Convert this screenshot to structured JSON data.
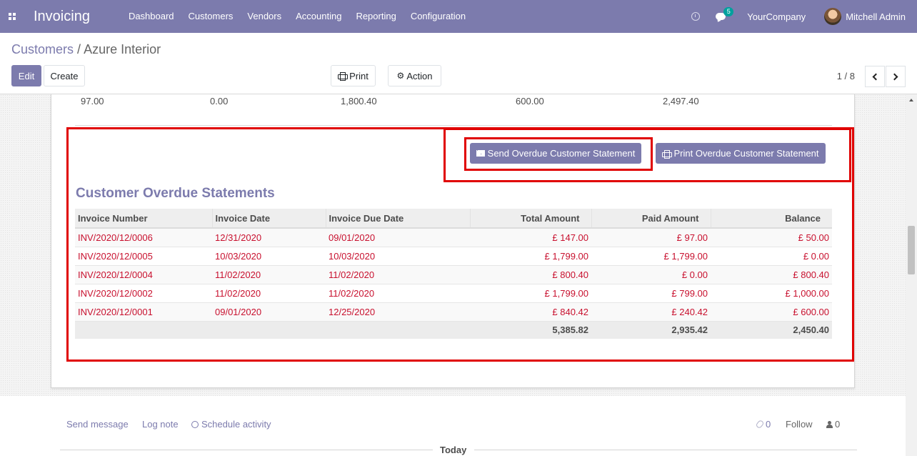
{
  "navbar": {
    "app_name": "Invoicing",
    "menu": [
      "Dashboard",
      "Customers",
      "Vendors",
      "Accounting",
      "Reporting",
      "Configuration"
    ],
    "chat_count": "5",
    "company": "YourCompany",
    "user": "Mitchell Admin",
    "bg_color": "#7c7bad"
  },
  "breadcrumb": {
    "parent": "Customers",
    "separator": "/",
    "current": "Azure Interior"
  },
  "toolbar": {
    "edit_label": "Edit",
    "create_label": "Create",
    "print_label": "Print",
    "action_label": "Action",
    "pager": "1 / 8"
  },
  "totals_row": [
    "97.00",
    "0.00",
    "1,800.40",
    "600.00",
    "2,497.40"
  ],
  "statement": {
    "send_label": "Send Overdue Customer Statement",
    "print_label": "Print Overdue Customer Statement",
    "title": "Customer Overdue Statements",
    "columns": [
      "Invoice Number",
      "Invoice Date",
      "Invoice Due Date",
      "Total Amount",
      "Paid Amount",
      "Balance"
    ],
    "rows": [
      [
        "INV/2020/12/0006",
        "12/31/2020",
        "09/01/2020",
        "£ 147.00",
        "£ 97.00",
        "£ 50.00"
      ],
      [
        "INV/2020/12/0005",
        "10/03/2020",
        "10/03/2020",
        "£ 1,799.00",
        "£ 1,799.00",
        "£ 0.00"
      ],
      [
        "INV/2020/12/0004",
        "11/02/2020",
        "11/02/2020",
        "£ 800.40",
        "£ 0.00",
        "£ 800.40"
      ],
      [
        "INV/2020/12/0002",
        "11/02/2020",
        "11/02/2020",
        "£ 1,799.00",
        "£ 799.00",
        "£ 1,000.00"
      ],
      [
        "INV/2020/12/0001",
        "09/01/2020",
        "12/25/2020",
        "£ 840.42",
        "£ 240.42",
        "£ 600.00"
      ]
    ],
    "total": [
      "5,385.82",
      "2,935.42",
      "2,450.40"
    ],
    "overdue_text_color": "#c8102e",
    "highlight_color": "#e00000"
  },
  "chatter": {
    "send_message": "Send message",
    "log_note": "Log note",
    "schedule_activity": "Schedule activity",
    "attachments_count": "0",
    "follow_label": "Follow",
    "followers_count": "0",
    "today_label": "Today"
  }
}
